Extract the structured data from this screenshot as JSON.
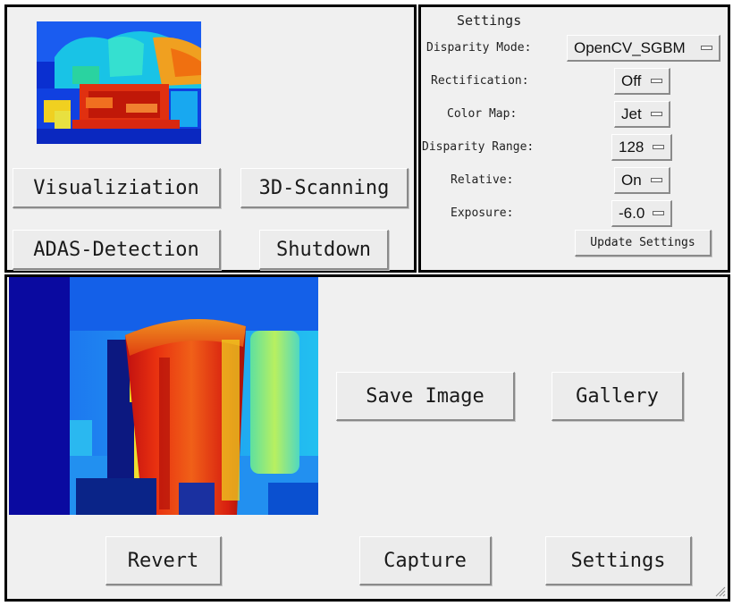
{
  "top_left": {
    "buttons": {
      "visualization": "Visualiziation",
      "scanning": "3D-Scanning",
      "adas": "ADAS-Detection",
      "shutdown": "Shutdown"
    }
  },
  "settings": {
    "title": "Settings",
    "rows": [
      {
        "label": "Disparity Mode:",
        "value": "OpenCV_SGBM"
      },
      {
        "label": "Rectification:",
        "value": "Off"
      },
      {
        "label": "Color Map:",
        "value": "Jet"
      },
      {
        "label": "Disparity Range:",
        "value": "128"
      },
      {
        "label": "Relative:",
        "value": "On"
      },
      {
        "label": "Exposure:",
        "value": "-6.0"
      }
    ],
    "update_button": "Update Settings"
  },
  "bottom": {
    "buttons": {
      "save_image": "Save Image",
      "gallery": "Gallery",
      "revert": "Revert",
      "capture": "Capture",
      "settings": "Settings"
    }
  },
  "icons": {
    "option_indicator": "option-menu-indicator-icon",
    "resize": "resize-grip-icon"
  }
}
